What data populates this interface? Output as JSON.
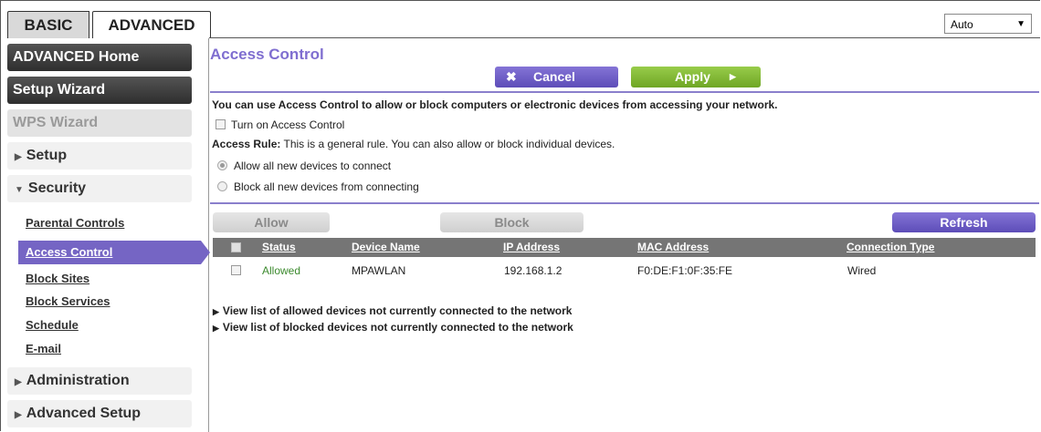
{
  "tabs": {
    "basic": "BASIC",
    "advanced": "ADVANCED"
  },
  "language": {
    "selected": "Auto"
  },
  "sidebar": {
    "home": "ADVANCED Home",
    "setup_wizard": "Setup Wizard",
    "wps_wizard": "WPS Wizard",
    "setup": "Setup",
    "security": "Security",
    "security_items": [
      "Parental Controls",
      "Access Control",
      "Block Sites",
      "Block Services",
      "Schedule",
      "E-mail"
    ],
    "administration": "Administration",
    "advanced_setup": "Advanced Setup"
  },
  "page": {
    "title": "Access Control",
    "cancel": "Cancel",
    "apply": "Apply",
    "intro": "You can use Access Control to allow or block computers or electronic devices from accessing your network.",
    "turn_on": "Turn on Access Control",
    "rule_label": "Access Rule:",
    "rule_text": " This is a general rule. You can also allow or block individual devices.",
    "opt_allow": "Allow all new devices to connect",
    "opt_block": "Block all new devices from connecting",
    "btn_allow": "Allow",
    "btn_block": "Block",
    "btn_refresh": "Refresh"
  },
  "table": {
    "headers": {
      "status": "Status",
      "device": "Device Name",
      "ip": "IP Address",
      "mac": "MAC Address",
      "conn": "Connection Type"
    },
    "rows": [
      {
        "status": "Allowed",
        "device": "MPAWLAN",
        "ip": "192.168.1.2",
        "mac": "F0:DE:F1:0F:35:FE",
        "conn": "Wired"
      }
    ]
  },
  "links": {
    "allowed": "View list of allowed devices not currently connected to the network",
    "blocked": "View list of blocked devices not currently connected to the network"
  },
  "colors": {
    "accent": "#7565c4",
    "apply": "#7fb52f",
    "allowed_text": "#3c8a2e",
    "table_header": "#757575"
  }
}
